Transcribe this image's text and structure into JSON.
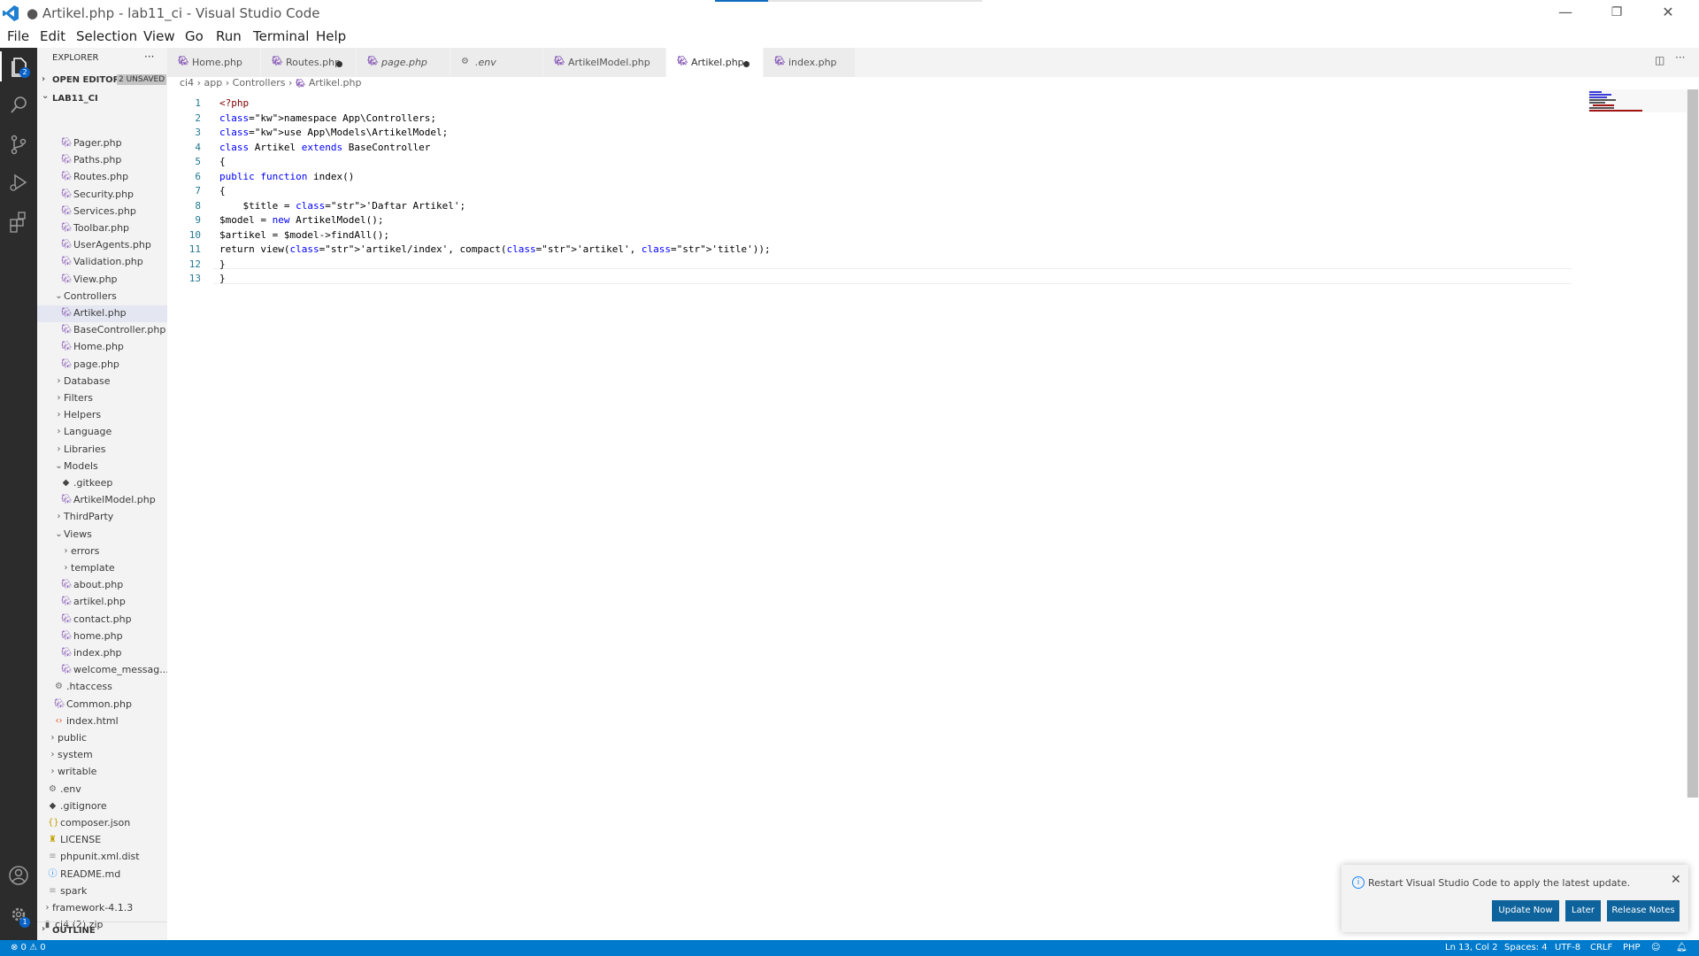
{
  "window": {
    "title": "● Artikel.php - lab11_ci - Visual Studio Code",
    "controls": {
      "minimize": "—",
      "restore": "❐",
      "close": "✕"
    }
  },
  "menu": [
    "File",
    "Edit",
    "Selection",
    "View",
    "Go",
    "Run",
    "Terminal",
    "Help"
  ],
  "activity_bar": {
    "explorer_badge": "2",
    "settings_badge": "1"
  },
  "sidebar": {
    "title": "EXPLORER",
    "more": "···",
    "open_editors": "OPEN EDITORS",
    "unsaved_badge": "2 UNSAVED",
    "project": "LAB11_CI",
    "items": [
      {
        "label": "Pager.php",
        "icon": "php"
      },
      {
        "label": "Paths.php",
        "icon": "php"
      },
      {
        "label": "Routes.php",
        "icon": "php"
      },
      {
        "label": "Security.php",
        "icon": "php"
      },
      {
        "label": "Services.php",
        "icon": "php"
      },
      {
        "label": "Toolbar.php",
        "icon": "php"
      },
      {
        "label": "UserAgents.php",
        "icon": "php"
      },
      {
        "label": "Validation.php",
        "icon": "php"
      },
      {
        "label": "View.php",
        "icon": "php"
      },
      {
        "label": "Controllers",
        "icon": "folder-open"
      },
      {
        "label": "Artikel.php",
        "icon": "php"
      },
      {
        "label": "BaseController.php",
        "icon": "php"
      },
      {
        "label": "Home.php",
        "icon": "php"
      },
      {
        "label": "page.php",
        "icon": "php"
      },
      {
        "label": "Database",
        "icon": "folder"
      },
      {
        "label": "Filters",
        "icon": "folder"
      },
      {
        "label": "Helpers",
        "icon": "folder"
      },
      {
        "label": "Language",
        "icon": "folder"
      },
      {
        "label": "Libraries",
        "icon": "folder"
      },
      {
        "label": "Models",
        "icon": "folder-open"
      },
      {
        "label": ".gitkeep",
        "icon": "git"
      },
      {
        "label": "ArtikelModel.php",
        "icon": "php"
      },
      {
        "label": "ThirdParty",
        "icon": "folder"
      },
      {
        "label": "Views",
        "icon": "folder-open"
      },
      {
        "label": "errors",
        "icon": "folder"
      },
      {
        "label": "template",
        "icon": "folder"
      },
      {
        "label": "about.php",
        "icon": "php"
      },
      {
        "label": "artikel.php",
        "icon": "php"
      },
      {
        "label": "contact.php",
        "icon": "php"
      },
      {
        "label": "home.php",
        "icon": "php"
      },
      {
        "label": "index.php",
        "icon": "php"
      },
      {
        "label": "welcome_messag...",
        "icon": "php"
      },
      {
        "label": ".htaccess",
        "icon": "gear"
      },
      {
        "label": "Common.php",
        "icon": "php"
      },
      {
        "label": "index.html",
        "icon": "html"
      },
      {
        "label": "public",
        "icon": "folder"
      },
      {
        "label": "system",
        "icon": "folder"
      },
      {
        "label": "writable",
        "icon": "folder"
      },
      {
        "label": ".env",
        "icon": "gear"
      },
      {
        "label": ".gitignore",
        "icon": "git"
      },
      {
        "label": "composer.json",
        "icon": "json"
      },
      {
        "label": "LICENSE",
        "icon": "license"
      },
      {
        "label": "phpunit.xml.dist",
        "icon": "file"
      },
      {
        "label": "README.md",
        "icon": "info"
      },
      {
        "label": "spark",
        "icon": "file"
      },
      {
        "label": "framework-4.1.3",
        "icon": "folder"
      },
      {
        "label": "ci4 (2).zip",
        "icon": "zip"
      }
    ],
    "outline": "OUTLINE"
  },
  "tabs": [
    {
      "label": "Home.php",
      "icon": "php"
    },
    {
      "label": "Routes.php",
      "icon": "php",
      "unsaved": true
    },
    {
      "label": "page.php",
      "icon": "php",
      "italic": true
    },
    {
      "label": ".env",
      "icon": "gear",
      "italic": true
    },
    {
      "label": "ArtikelModel.php",
      "icon": "php"
    },
    {
      "label": "Artikel.php",
      "icon": "php",
      "active": true,
      "unsaved": true
    },
    {
      "label": "index.php",
      "icon": "php"
    }
  ],
  "breadcrumb": [
    "ci4",
    "app",
    "Controllers",
    "Artikel.php"
  ],
  "editor": {
    "line_numbers": [
      "1",
      "2",
      "3",
      "4",
      "5",
      "6",
      "7",
      "8",
      "9",
      "10",
      "11",
      "12",
      "13"
    ],
    "lines": [
      "<?php",
      "namespace App\\Controllers;",
      "use App\\Models\\ArtikelModel;",
      "class Artikel extends BaseController",
      "{",
      "public function index()",
      "{",
      "    $title = 'Daftar Artikel';",
      "$model = new ArtikelModel();",
      "$artikel = $model->findAll();",
      "return view('artikel/index', compact('artikel', 'title'));",
      "}",
      "}"
    ]
  },
  "notification": {
    "message": "Restart Visual Studio Code to apply the latest update.",
    "buttons": [
      "Update Now",
      "Later",
      "Release Notes"
    ]
  },
  "statusbar": {
    "problems": "⊗ 0 ⚠ 0",
    "position": "Ln 13, Col 2",
    "spaces": "Spaces: 4",
    "encoding": "UTF-8",
    "eol": "CRLF",
    "language": "PHP"
  },
  "colors": {
    "accent": "#007acc",
    "activity_bar": "#2c2c2c",
    "button": "#0e639c",
    "keyword": "#0000ff",
    "string": "#a31515"
  }
}
